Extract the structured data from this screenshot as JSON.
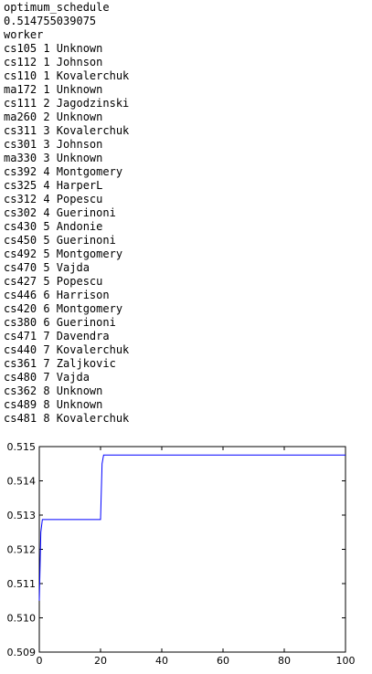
{
  "output": {
    "lines": [
      "optimum_schedule",
      "0.514755039075",
      "worker",
      "cs105 1 Unknown",
      "cs112 1 Johnson",
      "cs110 1 Kovalerchuk",
      "ma172 1 Unknown",
      "cs111 2 Jagodzinski",
      "ma260 2 Unknown",
      "cs311 3 Kovalerchuk",
      "cs301 3 Johnson",
      "ma330 3 Unknown",
      "cs392 4 Montgomery",
      "cs325 4 HarperL",
      "cs312 4 Popescu",
      "cs302 4 Guerinoni",
      "cs430 5 Andonie",
      "cs450 5 Guerinoni",
      "cs492 5 Montgomery",
      "cs470 5 Vajda",
      "cs427 5 Popescu",
      "cs446 6 Harrison",
      "cs420 6 Montgomery",
      "cs380 6 Guerinoni",
      "cs471 7 Davendra",
      "cs440 7 Kovalerchuk",
      "cs361 7 Zaljkovic",
      "cs480 7 Vajda",
      "cs362 8 Unknown",
      "cs489 8 Unknown",
      "cs481 8 Kovalerchuk"
    ]
  },
  "chart_data": {
    "type": "line",
    "title": "",
    "xlabel": "",
    "ylabel": "",
    "xlim": [
      0,
      100
    ],
    "ylim": [
      0.509,
      0.515
    ],
    "xticks": [
      "0",
      "20",
      "40",
      "60",
      "80",
      "100"
    ],
    "yticks": [
      "0.509",
      "0.510",
      "0.511",
      "0.512",
      "0.513",
      "0.514",
      "0.515"
    ],
    "grid": false,
    "line_color": "#0000ff",
    "series": [
      {
        "x": [
          0,
          0.5,
          1,
          1.5,
          20,
          20.5,
          21,
          100
        ],
        "y": [
          0.5105,
          0.5125,
          0.51287,
          0.51287,
          0.51287,
          0.5145,
          0.514755,
          0.514755
        ]
      }
    ]
  }
}
